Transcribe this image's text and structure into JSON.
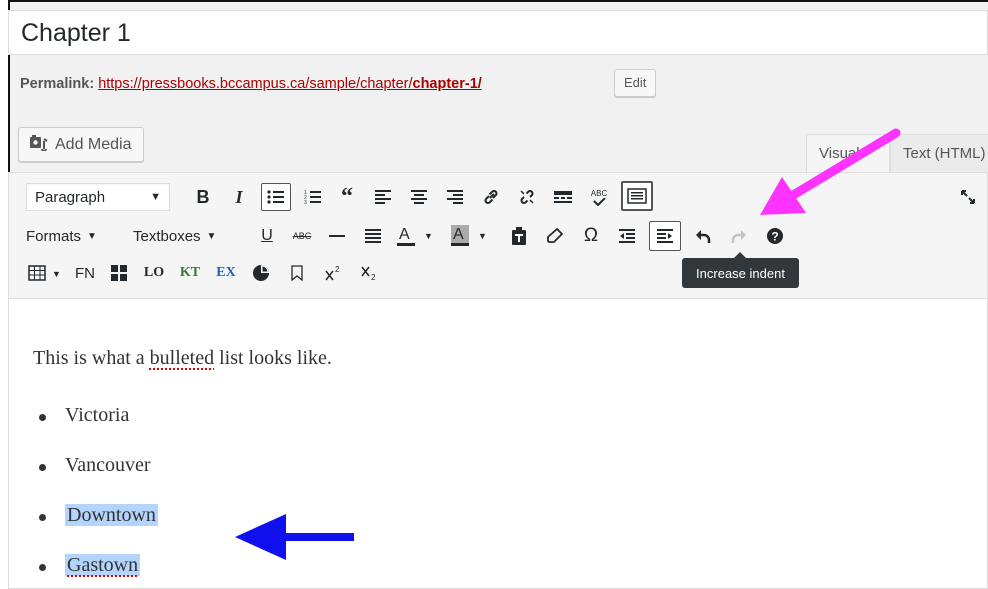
{
  "post": {
    "title": "Chapter 1",
    "permalink_label": "Permalink:",
    "permalink_prefix": "https://pressbooks.bccampus.ca/sample/chapter/",
    "permalink_slug": "chapter-1/",
    "edit_label": "Edit"
  },
  "media": {
    "add_media_label": "Add Media",
    "icon": "add-media-icon"
  },
  "tabs": [
    {
      "label": "Visual"
    },
    {
      "label": "Text (HTML)"
    }
  ],
  "toolbar": {
    "format_select": "Paragraph",
    "formats_menu": "Formats",
    "textboxes_menu": "Textboxes",
    "fn_label": "FN",
    "lo_label": "LO",
    "kt_label": "KT",
    "ex_label": "EX",
    "spell_label": "ABC",
    "strike_label": "ABC",
    "colors": {
      "kt": "#2e7d32",
      "ex": "#1565c0",
      "text_color_bar": "#23282d",
      "bg_color_bar": "#aaaaaa"
    },
    "tooltip": "Increase indent"
  },
  "content": {
    "paragraph_text": {
      "before": "This is what a ",
      "misspelled": "bulleted",
      "after": " list looks like."
    },
    "list_items": [
      {
        "text": "Victoria",
        "selected": false
      },
      {
        "text": "Vancouver",
        "selected": false
      },
      {
        "text": "Downtown",
        "selected": true
      },
      {
        "text": "Gastown",
        "selected": true
      }
    ]
  },
  "annotations": {
    "pink_arrow_color": "#ff33ff",
    "blue_arrow_color": "#1010ee"
  }
}
